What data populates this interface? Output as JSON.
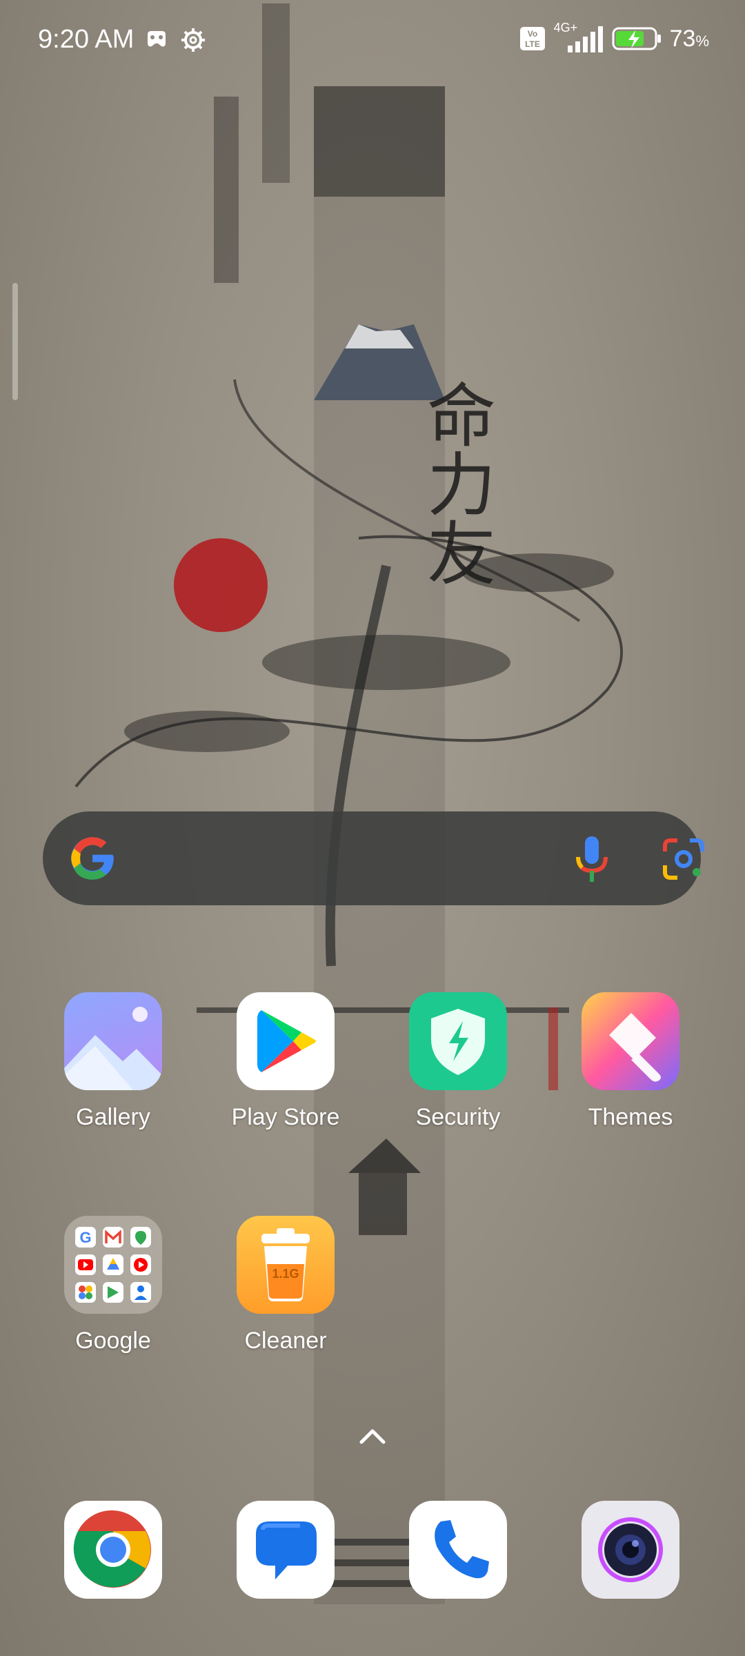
{
  "status_bar": {
    "time": "9:20 AM",
    "network": "4G+",
    "volte": "Vo LTE",
    "battery_percent": "73",
    "battery_unit": "%"
  },
  "wallpaper": {
    "calligraphy": "命力友"
  },
  "search_bar": {
    "provider": "Google"
  },
  "apps": [
    {
      "label": "Gallery"
    },
    {
      "label": "Play Store"
    },
    {
      "label": "Security"
    },
    {
      "label": "Themes"
    },
    {
      "label": "Google"
    },
    {
      "label": "Cleaner",
      "badge": "1.1G"
    }
  ],
  "dock": [
    {
      "name": "Chrome"
    },
    {
      "name": "Messages"
    },
    {
      "name": "Phone"
    },
    {
      "name": "Camera"
    }
  ],
  "colors": {
    "google_blue": "#4285F4",
    "google_red": "#EA4335",
    "google_yellow": "#FBBC05",
    "google_green": "#34A853",
    "security_green": "#1ec98f",
    "battery_green": "#57d93a"
  }
}
